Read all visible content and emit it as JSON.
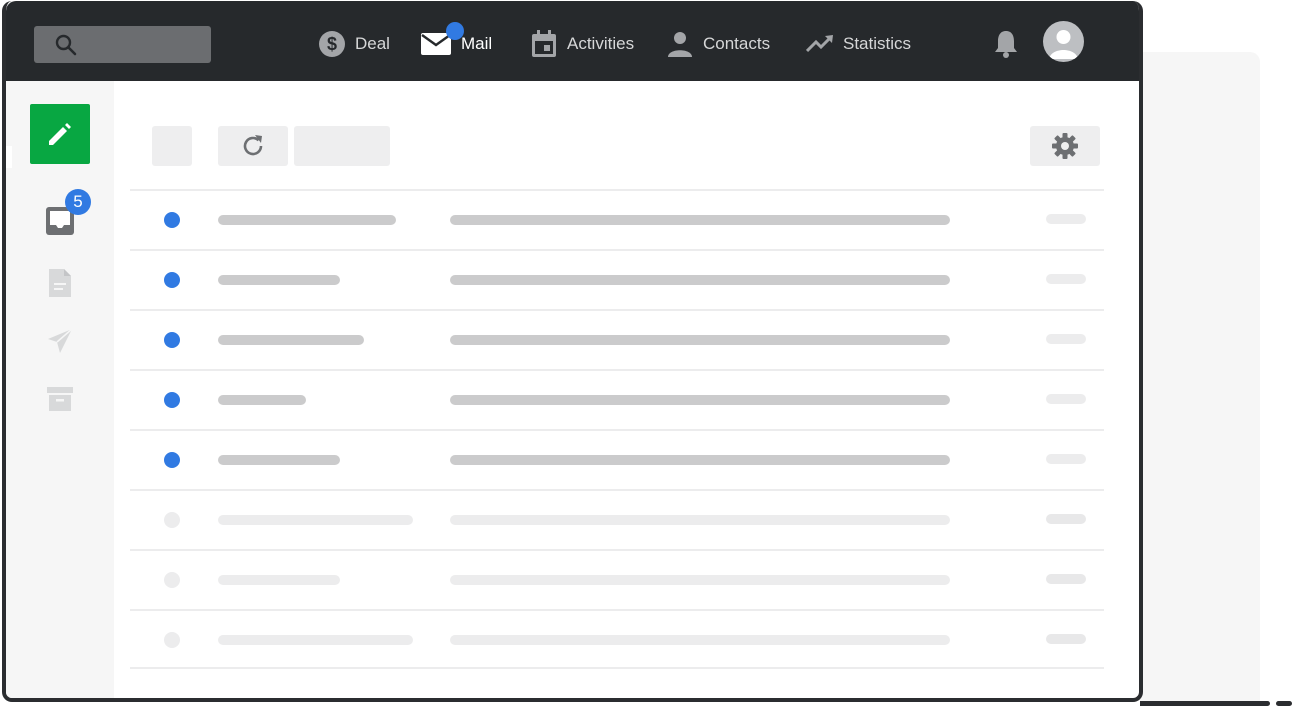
{
  "nav": {
    "items": [
      {
        "label": "Deal",
        "icon": "dollar-icon",
        "active": false
      },
      {
        "label": "Mail",
        "icon": "mail-icon",
        "active": true
      },
      {
        "label": "Activities",
        "icon": "calendar-icon",
        "active": false
      },
      {
        "label": "Contacts",
        "icon": "person-icon",
        "active": false
      },
      {
        "label": "Statistics",
        "icon": "trending-up-icon",
        "active": false
      }
    ]
  },
  "sidebar": {
    "inbox_badge": "5",
    "icons": [
      "pencil-icon",
      "inbox-icon",
      "document-icon",
      "send-icon",
      "archive-icon"
    ]
  },
  "toolbar": {
    "icons": [
      "refresh-icon",
      "gear-icon"
    ]
  },
  "mail_list": {
    "rows": [
      {
        "unread": true,
        "sender_width": 178
      },
      {
        "unread": true,
        "sender_width": 122
      },
      {
        "unread": true,
        "sender_width": 146
      },
      {
        "unread": true,
        "sender_width": 88
      },
      {
        "unread": true,
        "sender_width": 122
      },
      {
        "unread": false,
        "sender_width": 195
      },
      {
        "unread": false,
        "sender_width": 122
      },
      {
        "unread": false,
        "sender_width": 195
      }
    ]
  },
  "colors": {
    "topbar": "#26292c",
    "accent_blue": "#317ae2",
    "compose_green": "#08a742"
  }
}
